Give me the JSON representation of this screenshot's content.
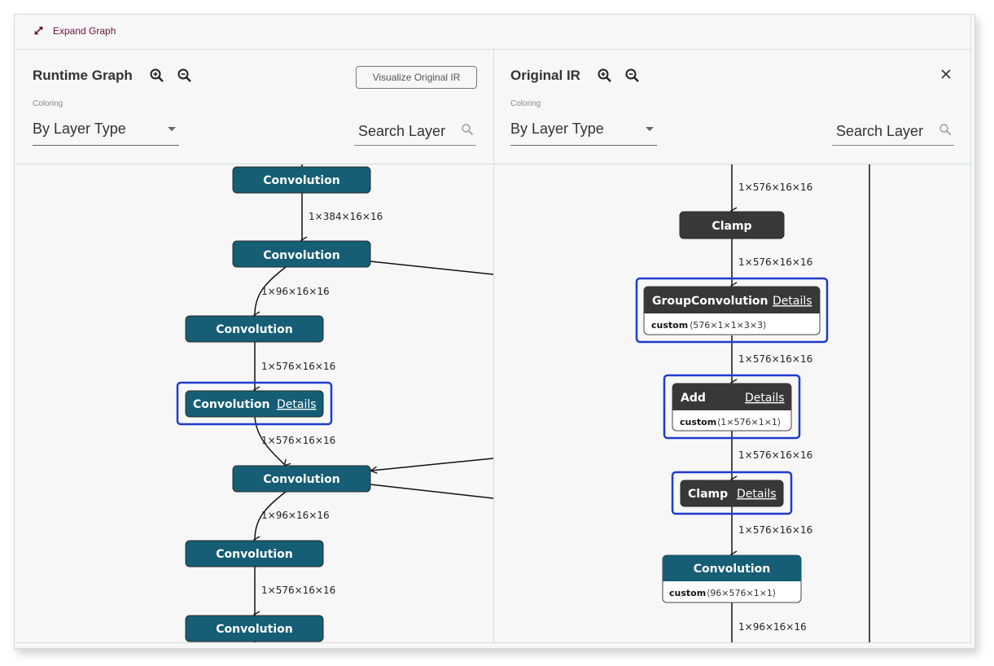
{
  "toolbar": {
    "expand_label": "Expand Graph",
    "expand_icon": "expand-diagonal-icon"
  },
  "colors": {
    "convolution_node": "#155e75",
    "dark_node": "#383838",
    "highlight_outline": "#1f3ccf",
    "expand_accent": "#6a1040"
  },
  "runtime_pane": {
    "title": "Runtime Graph",
    "zoom_in_icon": "zoom-in-icon",
    "zoom_out_icon": "zoom-out-icon",
    "visualize_button": "Visualize Original IR",
    "coloring_label": "Coloring",
    "coloring_value": "By Layer Type",
    "search_placeholder": "Search Layer",
    "nodes": [
      {
        "id": "n1",
        "label": "Convolution",
        "type": "convolution"
      },
      {
        "id": "n2",
        "label": "Convolution",
        "type": "convolution"
      },
      {
        "id": "n3",
        "label": "Convolution",
        "type": "convolution"
      },
      {
        "id": "n4",
        "label": "Convolution",
        "type": "convolution",
        "highlighted": true,
        "details_label": "Details"
      },
      {
        "id": "n5",
        "label": "Convolution",
        "type": "convolution"
      },
      {
        "id": "n6",
        "label": "Convolution",
        "type": "convolution"
      },
      {
        "id": "n7",
        "label": "Convolution",
        "type": "convolution"
      }
    ],
    "edges": [
      {
        "from": "n1",
        "to": "n2",
        "label": "1×384×16×16"
      },
      {
        "from": "n2",
        "to": "n3",
        "label": "1×96×16×16"
      },
      {
        "from": "n3",
        "to": "n4",
        "label": "1×576×16×16"
      },
      {
        "from": "n4",
        "to": "n5",
        "label": "1×576×16×16"
      },
      {
        "from": "n5",
        "to": "n6",
        "label": "1×96×16×16"
      },
      {
        "from": "n6",
        "to": "n7",
        "label": "1×576×16×16"
      }
    ]
  },
  "original_pane": {
    "title": "Original IR",
    "zoom_in_icon": "zoom-in-icon",
    "zoom_out_icon": "zoom-out-icon",
    "close_icon": "close-icon",
    "coloring_label": "Coloring",
    "coloring_value": "By Layer Type",
    "search_placeholder": "Search Layer",
    "nodes": [
      {
        "id": "o1",
        "label": "Clamp",
        "type": "dark"
      },
      {
        "id": "o2",
        "label": "GroupConvolution",
        "type": "dark",
        "highlighted": true,
        "details_label": "Details",
        "attr_key": "custom",
        "attr_val": "⟨576×1×1×3×3⟩"
      },
      {
        "id": "o3",
        "label": "Add",
        "type": "dark",
        "highlighted": true,
        "details_label": "Details",
        "attr_key": "custom",
        "attr_val": "⟨1×576×1×1⟩"
      },
      {
        "id": "o4",
        "label": "Clamp",
        "type": "dark",
        "highlighted": true,
        "details_label": "Details"
      },
      {
        "id": "o5",
        "label": "Convolution",
        "type": "convolution",
        "attr_key": "custom",
        "attr_val": "⟨96×576×1×1⟩"
      }
    ],
    "edges": [
      {
        "from": null,
        "to": "o1",
        "label": "1×576×16×16"
      },
      {
        "from": "o1",
        "to": "o2",
        "label": "1×576×16×16"
      },
      {
        "from": "o2",
        "to": "o3",
        "label": "1×576×16×16"
      },
      {
        "from": "o3",
        "to": "o4",
        "label": "1×576×16×16"
      },
      {
        "from": "o4",
        "to": "o5",
        "label": "1×576×16×16"
      },
      {
        "from": "o5",
        "to": null,
        "label": "1×96×16×16"
      }
    ]
  }
}
